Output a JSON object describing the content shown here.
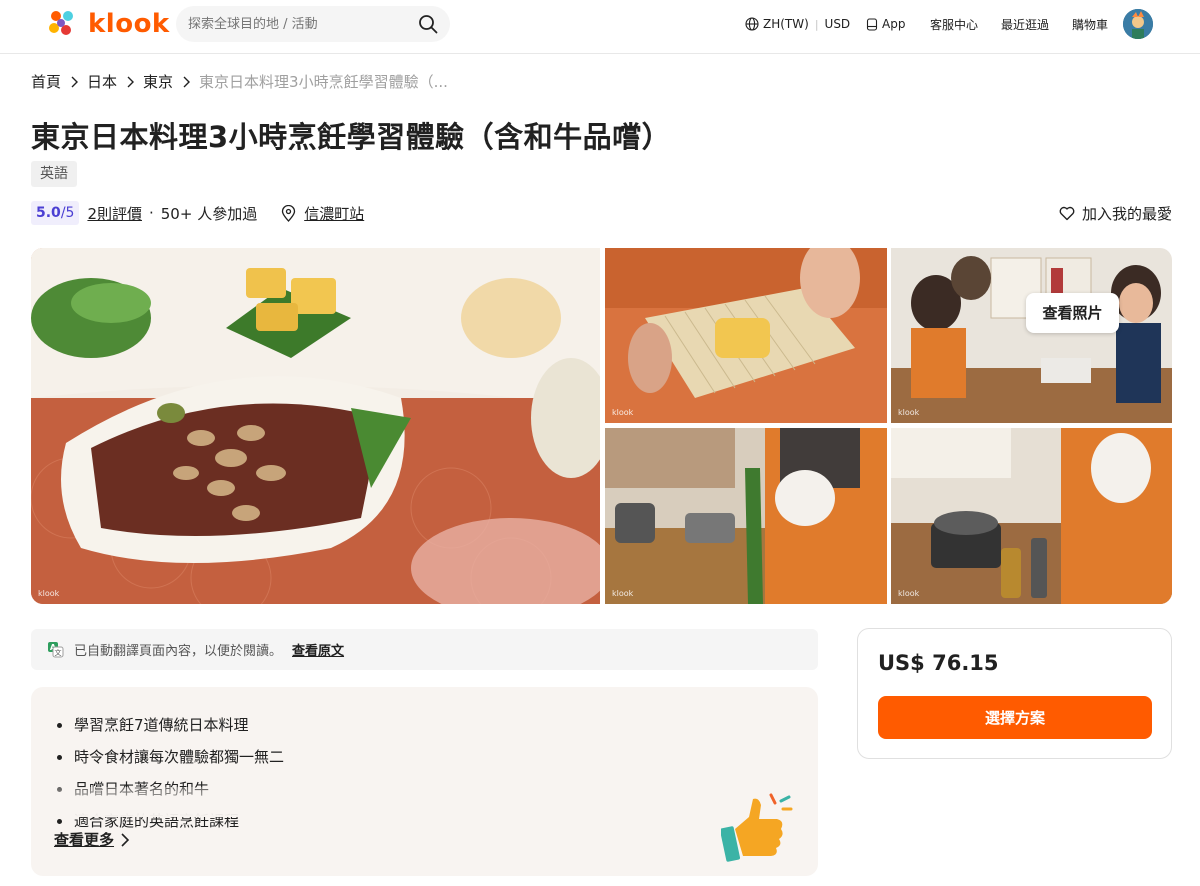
{
  "header": {
    "brand": "klook",
    "search_placeholder": "探索全球目的地 / 活動",
    "language": "ZH(TW)",
    "currency": "USD",
    "app_label": "App",
    "service_label": "客服中心",
    "recent_label": "最近逛過",
    "cart_label": "購物車"
  },
  "breadcrumb": [
    "首頁",
    "日本",
    "東京",
    "東京日本料理3小時烹飪學習體驗（..."
  ],
  "product": {
    "title": "東京日本料理3小時烹飪學習體驗（含和牛品嚐）",
    "language_tag": "英語",
    "rating": "5.0",
    "rating_max": "/5",
    "reviews": "2則評價",
    "participants": "50+ 人參加過",
    "location": "信濃町站",
    "favorite": "加入我的最愛"
  },
  "gallery": {
    "watermark": "klook",
    "view_photos": "查看照片"
  },
  "notice": {
    "text": "已自動翻譯頁面內容，以便於閱讀。",
    "link": "查看原文"
  },
  "highlights": {
    "items": [
      "學習烹飪7道傳統日本料理",
      "時令食材讓每次體驗都獨一無二",
      "品嚐日本著名的和牛",
      "適合家庭的英語烹飪課程"
    ],
    "see_more": "查看更多"
  },
  "booking": {
    "price": "US$ 76.15",
    "select_label": "選擇方案"
  },
  "colors": {
    "brand": "#ff5b00",
    "rating_bg": "#f0eefc",
    "rating_text": "#4b3fd3",
    "highlight_bg": "#f8f4f1"
  }
}
